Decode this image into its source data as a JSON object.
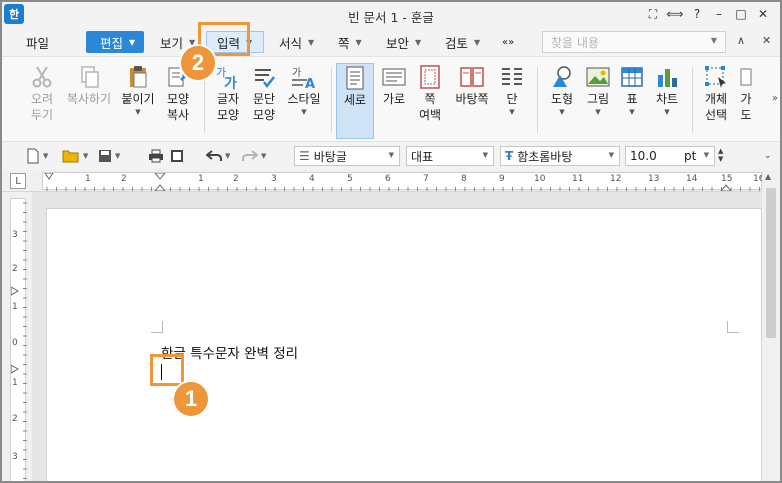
{
  "window": {
    "app_icon": "한",
    "title": "빈 문서 1 - 훈글",
    "controls": [
      "⛶",
      "⟺",
      "?",
      "–",
      "□",
      "✕"
    ]
  },
  "menu": {
    "file": "파일",
    "edit": "편집",
    "view": "보기",
    "input": "입력",
    "format": "서식",
    "page": "쪽",
    "security": "보안",
    "review": "검토",
    "tools": "«»",
    "search_placeholder": "찾을 내용",
    "collapse": "∧",
    "close_doc": "✕"
  },
  "ribbon": {
    "cut": [
      "오려",
      "두기"
    ],
    "copy": "복사하기",
    "paste": "붙이기",
    "format_copy": [
      "모양",
      "복사"
    ],
    "char_shape": [
      "글자",
      "모양"
    ],
    "para_shape": [
      "문단",
      "모양"
    ],
    "style": "스타일",
    "portrait": "세로",
    "landscape": "가로",
    "page_margin": [
      "쪽",
      "여백"
    ],
    "page_bg": "바탕쪽",
    "columns": "단",
    "shapes": "도형",
    "picture": "그림",
    "table": "표",
    "chart": "차트",
    "select_object": [
      "개체",
      "선택"
    ],
    "more_label": [
      "가",
      "도"
    ]
  },
  "toolbar": {
    "style_name": "바탕글",
    "para_style": "대표",
    "font_name": "함초롬바탕",
    "font_size": "10.0",
    "font_unit": "pt"
  },
  "ruler": {
    "h_numbers": [
      "1",
      "2",
      "1",
      "1",
      "2",
      "3",
      "4",
      "5",
      "6",
      "7",
      "8",
      "9",
      "10",
      "11",
      "12",
      "13",
      "14",
      "15",
      "16"
    ],
    "v_numbers": [
      "3",
      "2",
      "1",
      "0",
      "1",
      "2",
      "3"
    ]
  },
  "document": {
    "text_line": "한글 특수문자 완벽 정리"
  },
  "callouts": {
    "step1": "1",
    "step2": "2"
  },
  "colors": {
    "accent": "#2b88d8",
    "callout": "#f0963a",
    "active_tab": "#dcecfa"
  }
}
